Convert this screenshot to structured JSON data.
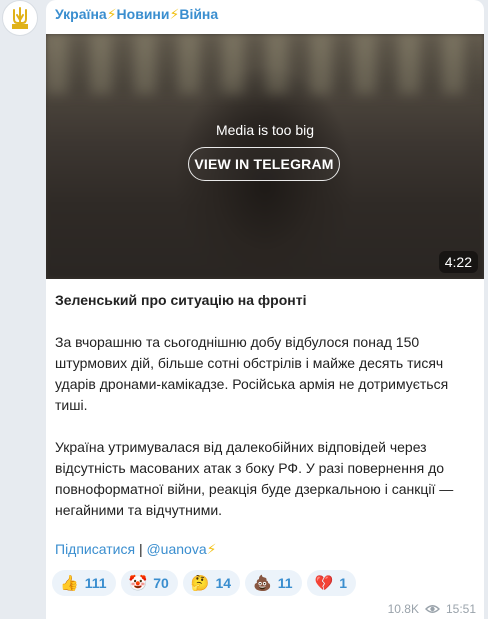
{
  "channel": {
    "name_part1": "Україна",
    "name_part2": "Новини",
    "name_part3": "Війна",
    "bolt": "⚡"
  },
  "media": {
    "notice": "Media is too big",
    "button_label": "VIEW IN TELEGRAM",
    "duration": "4:22"
  },
  "post": {
    "title": "Зеленський про ситуацію на фронті",
    "paragraph1": "За вчорашню та сьогоднішню добу відбулося понад 150 штурмових дій, більше сотні обстрілів і майже десять тисяч ударів дронами-камікадзе. Російська армія не дотримується тиші.",
    "paragraph2": "Україна утримувалася від далекобійних відповідей через відсутність масованих атак з боку РФ. У разі повернення до повноформатної війни, реакція буде дзеркальною і санкції — негайними та відчутними."
  },
  "links": {
    "subscribe": "Підписатися",
    "separator": "|",
    "handle": "@uanova"
  },
  "reactions": [
    {
      "emoji": "👍",
      "count": "111"
    },
    {
      "emoji": "🤡",
      "count": "70"
    },
    {
      "emoji": "🤔",
      "count": "14"
    },
    {
      "emoji": "💩",
      "count": "11"
    },
    {
      "emoji": "💔",
      "count": "1"
    }
  ],
  "meta": {
    "views": "10.8K",
    "time": "15:51"
  },
  "colors": {
    "link": "#3a8ecf",
    "bolt": "#f2c21a",
    "reaction_bg": "#ecf3fa"
  }
}
